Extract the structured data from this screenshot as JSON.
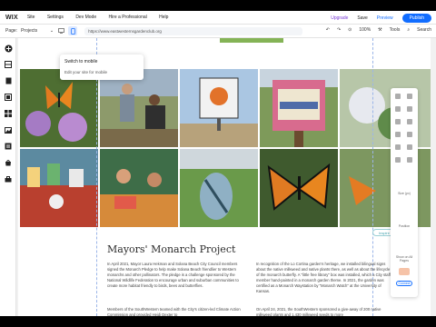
{
  "topbar": {
    "logo": "WIX",
    "menu": [
      "Site",
      "Settings",
      "Dev Mode",
      "Hire a Professional",
      "Help"
    ],
    "upgrade": "Upgrade",
    "save": "Save",
    "preview": "Preview",
    "publish": "Publish"
  },
  "secondbar": {
    "page_label": "Page:",
    "page_value": "Projects",
    "url": "https://www.eastwesternsgardenclub.org",
    "zoom": "100%",
    "tools": "Tools",
    "search": "Search"
  },
  "tooltip": {
    "title": "Switch to mobile",
    "text": "Edit your site for mobile"
  },
  "content": {
    "heading": "Mayors' Monarch Project",
    "badge": "Inspire",
    "left_para": "In April 2021, Mayor Laura Hekman and Solana Beach City Council members signed the Monarch Pledge to help make Solana Beach friendlier to Western monarchs and other pollinators. The pledge is a challenge sponsored by the National Wildlife Federation to encourage urban and suburban communities to create more habitat friendly to birds, bees and butterflies.",
    "left_para2": "Members of the SouthWestern teamed with the City's citizen-led Climate Action Commission and provided Heidi Dexter to",
    "right_para": "In recognition of the Lo Cortina garden's heritage, we installed bilingual signs about the native milkweed and native plants there, as well as about the lifecycle of the monarch butterfly. A \"little free library\" box was installed, which a City staff member hand-painted in a monarch garden theme. In 2021, the garden was certified as a Monarch Waystation by \"Monarch Watch\" at the University of Kansas.",
    "right_para2": "On April 24, 2021, the SouthWestern sponsored a give-away of 200 native milkweed plants and 1,430 milkweed seeds to more"
  },
  "right_panel": {
    "label1": "Size (px)",
    "label2": "Position",
    "label3": "Show on All Pages",
    "button": "Connect"
  },
  "colors": {
    "brand_blue": "#116dff",
    "upgrade_purple": "#7a3cd6",
    "green_bar": "#84b356"
  }
}
